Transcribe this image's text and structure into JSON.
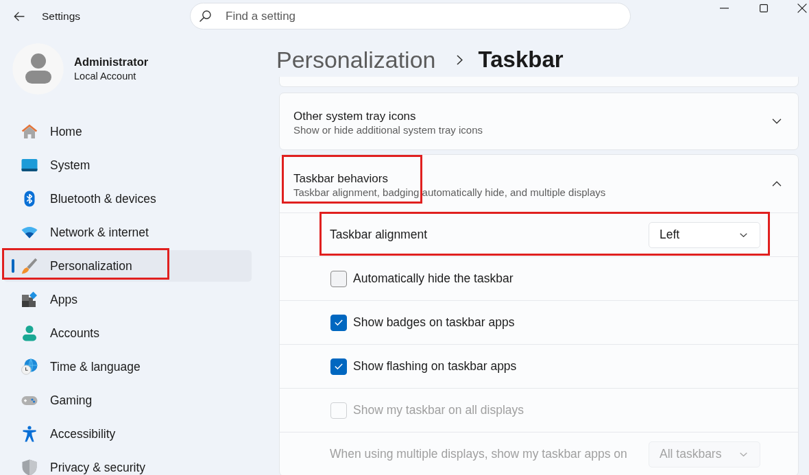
{
  "window": {
    "title": "Settings"
  },
  "search": {
    "placeholder": "Find a setting"
  },
  "account": {
    "name": "Administrator",
    "type": "Local Account"
  },
  "sidebar": {
    "items": [
      {
        "label": "Home",
        "selected": false,
        "highlighted": false
      },
      {
        "label": "System",
        "selected": false,
        "highlighted": false
      },
      {
        "label": "Bluetooth & devices",
        "selected": false,
        "highlighted": false
      },
      {
        "label": "Network & internet",
        "selected": false,
        "highlighted": false
      },
      {
        "label": "Personalization",
        "selected": true,
        "highlighted": true
      },
      {
        "label": "Apps",
        "selected": false,
        "highlighted": false
      },
      {
        "label": "Accounts",
        "selected": false,
        "highlighted": false
      },
      {
        "label": "Time & language",
        "selected": false,
        "highlighted": false
      },
      {
        "label": "Gaming",
        "selected": false,
        "highlighted": false
      },
      {
        "label": "Accessibility",
        "selected": false,
        "highlighted": false
      },
      {
        "label": "Privacy & security",
        "selected": false,
        "highlighted": false
      }
    ]
  },
  "page": {
    "parent": "Personalization",
    "title": "Taskbar"
  },
  "cards": [
    {
      "title": "Other system tray icons",
      "subtitle": "Show or hide additional system tray icons",
      "expanded": false,
      "highlighted": false
    },
    {
      "title": "Taskbar behaviors",
      "subtitle": "Taskbar alignment, badging automatically hide, and multiple displays",
      "expanded": true,
      "highlighted": true,
      "settings": [
        {
          "kind": "dropdown",
          "label": "Taskbar alignment",
          "value": "Left",
          "disabled": false,
          "highlighted": true
        },
        {
          "kind": "checkbox",
          "label": "Automatically hide the taskbar",
          "checked": false,
          "disabled": false,
          "highlighted": false
        },
        {
          "kind": "checkbox",
          "label": "Show badges on taskbar apps",
          "checked": true,
          "disabled": false,
          "highlighted": false
        },
        {
          "kind": "checkbox",
          "label": "Show flashing on taskbar apps",
          "checked": true,
          "disabled": false,
          "highlighted": false
        },
        {
          "kind": "checkbox",
          "label": "Show my taskbar on all displays",
          "checked": false,
          "disabled": true,
          "highlighted": false
        },
        {
          "kind": "dropdown",
          "label": "When using multiple displays, show my taskbar apps on",
          "value": "All taskbars",
          "disabled": true,
          "highlighted": false
        }
      ]
    }
  ]
}
